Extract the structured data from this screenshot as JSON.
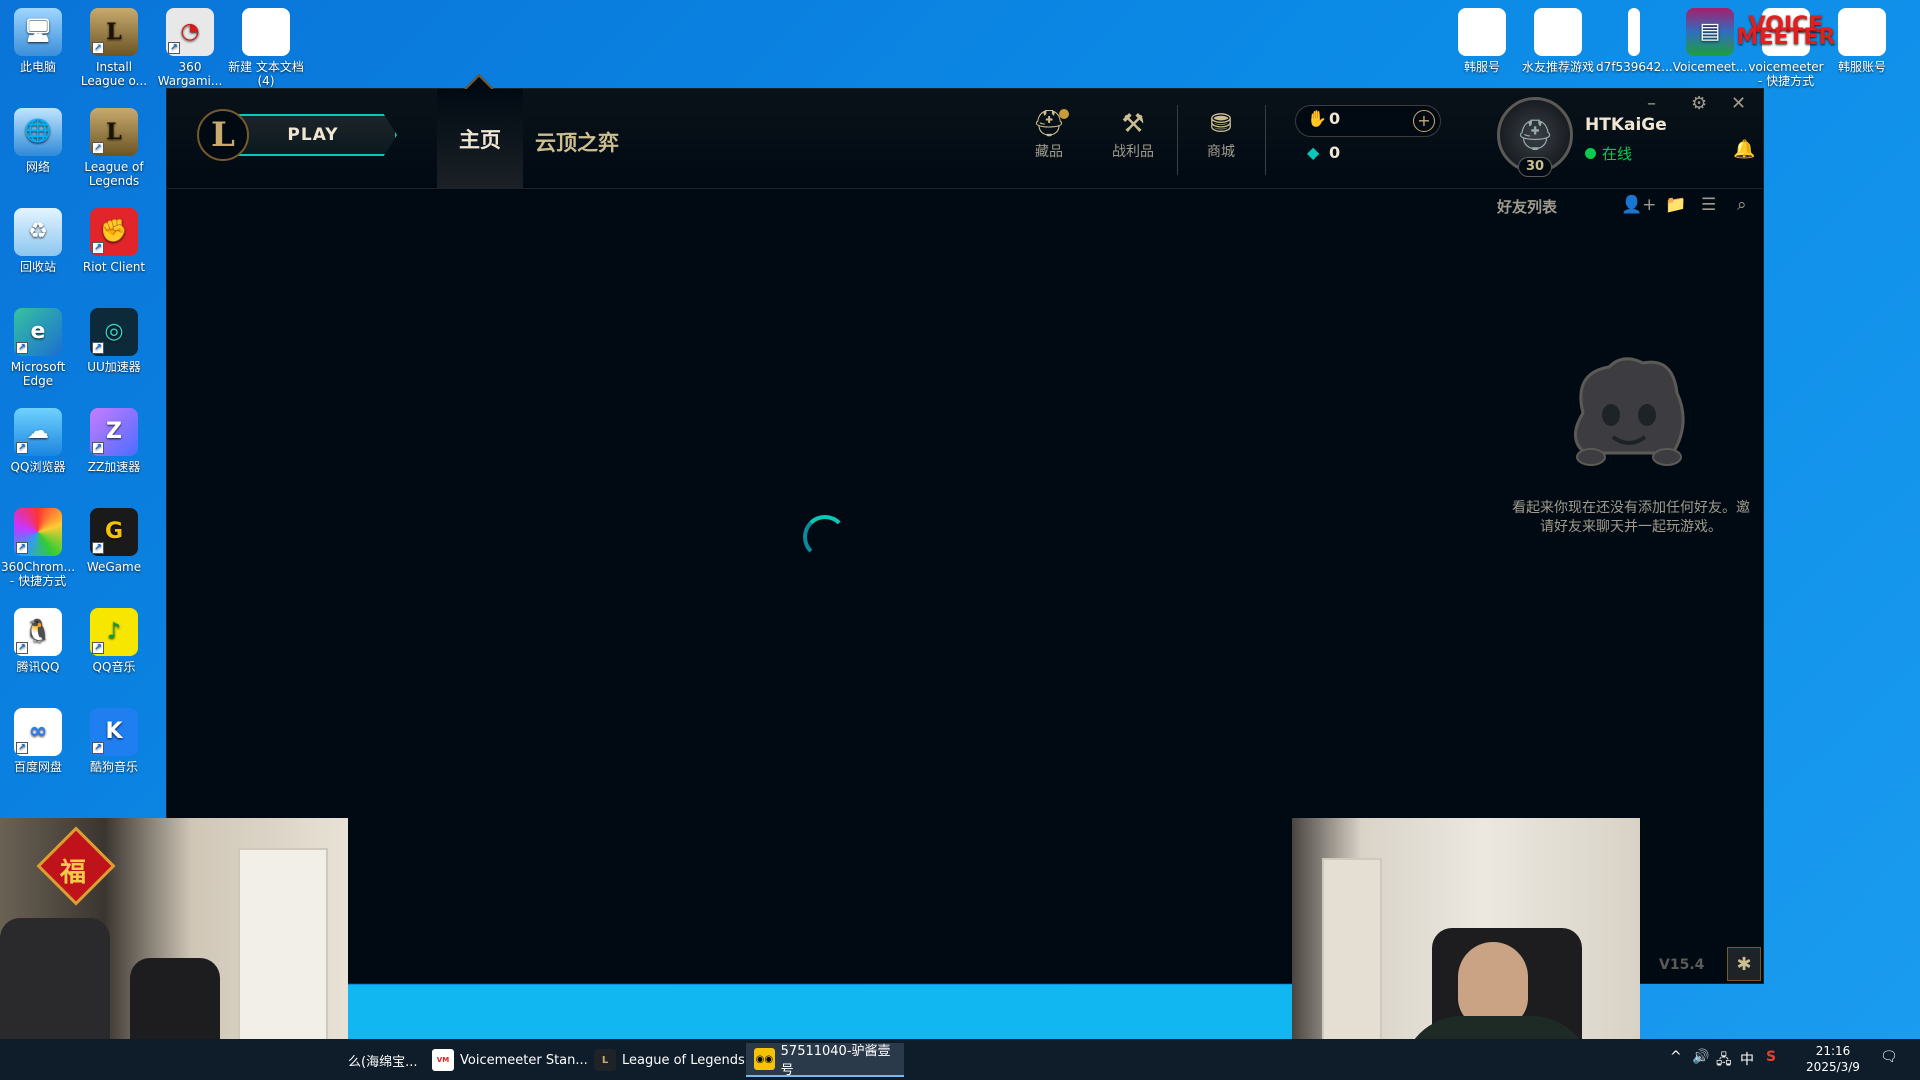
{
  "desktop": {
    "left_icons": [
      {
        "label": "此电脑",
        "icon": "computer-icon"
      },
      {
        "label": "Install League o...",
        "icon": "lol-installer-icon"
      },
      {
        "label": "360 Wargami...",
        "icon": "360-wargaming-icon"
      },
      {
        "label": "新建 文本文档 (4)",
        "icon": "text-file-icon"
      },
      {
        "label": "网络",
        "icon": "network-icon"
      },
      {
        "label": "League of Legends",
        "icon": "lol-icon"
      },
      {
        "label": "回收站",
        "icon": "recycle-bin-icon"
      },
      {
        "label": "Riot Client",
        "icon": "riot-client-icon"
      },
      {
        "label": "Microsoft Edge",
        "icon": "edge-icon"
      },
      {
        "label": "UU加速器",
        "icon": "uu-accelerator-icon"
      },
      {
        "label": "QQ浏览器",
        "icon": "qq-browser-icon"
      },
      {
        "label": "ZZ加速器",
        "icon": "zz-accelerator-icon"
      },
      {
        "label": "360Chrom... - 快捷方式",
        "icon": "360-chrome-icon"
      },
      {
        "label": "WeGame",
        "icon": "wegame-icon"
      },
      {
        "label": "腾讯QQ",
        "icon": "qq-icon"
      },
      {
        "label": "QQ音乐",
        "icon": "qq-music-icon"
      },
      {
        "label": "百度网盘",
        "icon": "baidu-netdisk-icon"
      },
      {
        "label": "酷狗音乐",
        "icon": "kugou-music-icon"
      }
    ],
    "right_icons": [
      {
        "label": "韩服号",
        "icon": "text-file-icon"
      },
      {
        "label": "水友推荐游戏",
        "icon": "text-file-icon"
      },
      {
        "label": "d7f539642...",
        "icon": "file-icon"
      },
      {
        "label": "Voicemeet...",
        "icon": "winrar-icon"
      },
      {
        "label": "voicemeeter - 快捷方式",
        "icon": "voicemeeter-icon"
      },
      {
        "label": "韩服账号",
        "icon": "text-file-icon"
      }
    ],
    "voicemeeter_logo_text": "VOICE MEETER"
  },
  "client": {
    "play_label": "PLAY",
    "nav": {
      "home": "主页",
      "tft": "云顶之弈"
    },
    "top_icons": [
      {
        "label": "藏品",
        "icon": "collection-icon",
        "has_notification": true
      },
      {
        "label": "战利品",
        "icon": "loot-icon"
      },
      {
        "label": "商城",
        "icon": "store-icon"
      }
    ],
    "currency": {
      "blue_essence": "0",
      "riot_points": "0"
    },
    "profile": {
      "username": "HTKaiGe",
      "status": "在线",
      "level": "30"
    },
    "social": {
      "title": "好友列表",
      "empty_message": "看起来你现在还没有添加任何好友。邀请好友来聊天并一起玩游戏。"
    },
    "version": "V15.4"
  },
  "taskbar": {
    "items": [
      {
        "label": "么(海绵宝...",
        "icon": "app-icon",
        "active": false
      },
      {
        "label": "Voicemeeter Stan...",
        "icon": "voicemeeter-icon",
        "active": false
      },
      {
        "label": "League of Legends",
        "icon": "lol-icon",
        "active": false
      },
      {
        "label": "57511040-驴酱壹号",
        "icon": "owl-app-icon",
        "active": true
      }
    ],
    "tray": {
      "ime": "中"
    },
    "clock": {
      "time": "21:16",
      "date": "2025/3/9"
    }
  },
  "colors": {
    "accent_teal": "#0ac8b9",
    "gold": "#c8aa6e",
    "online_green": "#0acb4d",
    "client_bg": "#010a13"
  }
}
